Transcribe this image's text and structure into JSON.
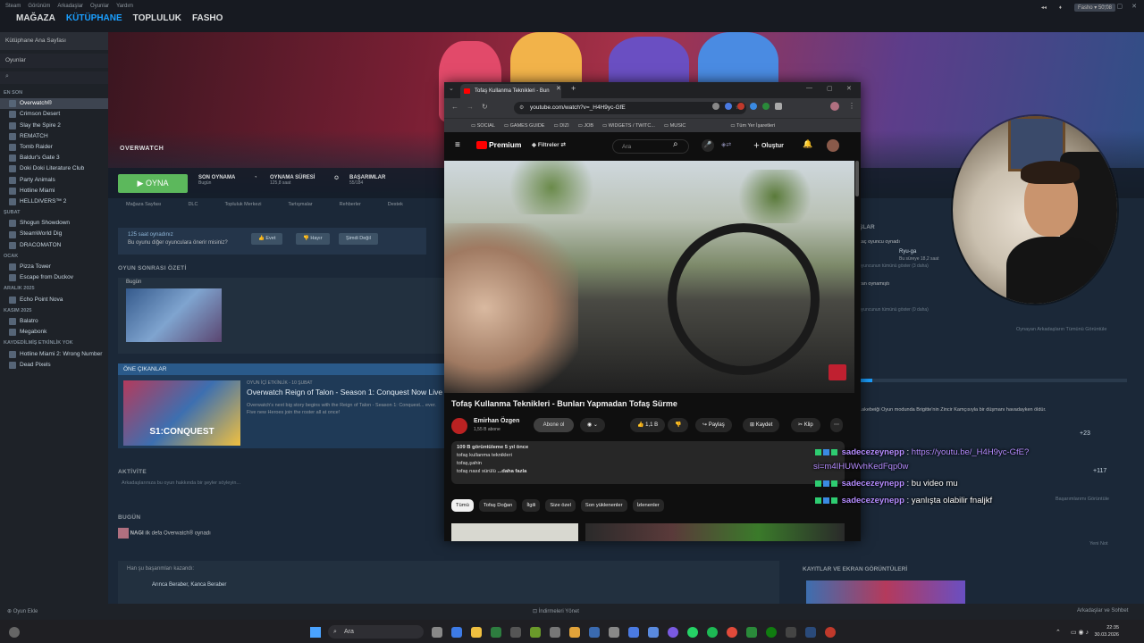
{
  "steam": {
    "menu": [
      "Steam",
      "Görünüm",
      "Arkadaşlar",
      "Oyunlar",
      "Yardım"
    ],
    "nav": [
      "MAĞAZA",
      "KÜTÜPHANE",
      "TOPLULUK",
      "FASHO"
    ],
    "account_name": "Fasho ▾ 50,08",
    "sidebar": {
      "home": "Kütüphane Ana Sayfası",
      "filter": "Oyunlar",
      "sections": [
        {
          "label": "EN SON",
          "games": [
            "Overwatch®",
            "Crimson Desert",
            "Slay the Spire 2",
            "REMATCH",
            "Tomb Raider",
            "Baldur's Gate 3",
            "Doki Doki Literature Club",
            "Party Animals",
            "Hotline Miami",
            "HELLDIVERS™ 2"
          ]
        },
        {
          "label": "ŞUBAT",
          "games": [
            "Shogun Showdown",
            "SteamWorld Dig",
            "DRACOMATON"
          ]
        },
        {
          "label": "OCAK",
          "games": [
            "Pizza Tower",
            "Escape from Duckov"
          ]
        },
        {
          "label": "ARALIK 2025",
          "games": [
            "Echo Point Nova"
          ]
        },
        {
          "label": "KASIM 2025",
          "games": [
            "Balatro",
            "Megabonk"
          ]
        },
        {
          "label": "KAYDEDİLMİŞ ETKİNLİK YOK",
          "games": [
            "Hotline Miami 2: Wrong Number",
            "Dead Pixels"
          ]
        }
      ]
    },
    "game": {
      "logo": "OVERWATCH",
      "play": "OYNA",
      "last_played_label": "SON OYNAMA",
      "last_played_value": "Bugün",
      "playtime_label": "OYNAMA SÜRESİ",
      "playtime_value": "125,8 saat",
      "achievements_label": "BAŞARIMLAR",
      "achievements_value": "55/184",
      "subnav": [
        "Mağaza Sayfası",
        "DLC",
        "Topluluk Merkezi",
        "Tartışmalar",
        "Rehberler",
        "Destek"
      ],
      "rec_line1": "125 saat oynadınız",
      "rec_line2": "Bu oyunu diğer oyunculara önerir misiniz?",
      "rec_yes": "Evet",
      "rec_no": "Hayır",
      "rec_later": "Şimdi Değil",
      "post_title": "OYUN SONRASI ÖZETİ",
      "post_today": "Bugün",
      "featured_head": "ÖNE ÇIKANLAR",
      "featured_meta": "OYUN İÇİ ETKİNLİK - 10 ŞUBAT",
      "featured_title": "Overwatch Reign of Talon - Season 1: Conquest Now Live",
      "featured_desc": "Overwatch's next big story begins with the Reign of Talon - Season 1: Conquest... ever. Five new Heroes join the roster all at once!",
      "featured_img_text": "S1:CONQUEST",
      "activity_title": "AKTİVİTE",
      "activity_placeholder": "Arkadaşlarınıza bu oyun hakkında bir şeyler söyleyin...",
      "today_title": "BUGÜN",
      "today_entry_name": "NAGI",
      "today_entry_text": "ilk defa",
      "today_entry_game": "Overwatch® oynadı",
      "ach_line": "Han şu başarımları kazandı:",
      "ach_name": "Arınca Beraber, Kanca Beraber",
      "friends_title": "ŞLAR",
      "friend_played": "kaç oyuncu oynadı",
      "friend_name": "Ryu-ga",
      "friend_sub": "Bu süreye 18,2 saat",
      "friend_link1": "oyuncunun tümünü göster (3 daha)",
      "friend_played2": "zan oynamıştı",
      "friend_link2": "oyuncunun tümünü göster (0 daha)",
      "friends_footer": "Oynayan Arkadaşların Tümünü Görüntüle",
      "ach_desc": "Lakebeiği Oyun modunda Brigitte'nin Zincir Kamçısıyla bir düşmanı havadayken öldür.",
      "ach_more1": "+23",
      "ach_more2": "+117",
      "ach_view_all": "Başarımlarımı Görüntüle",
      "news_view": "Yeni Not",
      "screens_title": "KAYITLAR VE EKRAN GÖRÜNTÜLERİ"
    },
    "status_left": "Oyun Ekle",
    "status_center": "İndirmeleri Yönet",
    "status_right": "Arkadaşlar ve Sohbet"
  },
  "browser": {
    "tab_title": "Tofaş Kullanma Teknikleri - Bun",
    "url": "youtube.com/watch?v=_H4H9yc-GfE",
    "bookmarks": [
      "SOCIAL",
      "GAMES GUIDE",
      "DIZI",
      "JOB",
      "WIDGETS / TWITC...",
      "MUSIC"
    ],
    "bookmarks_right": "Tüm Yer İşaretleri"
  },
  "youtube": {
    "logo": "Premium",
    "filters": "Filtreler",
    "search_placeholder": "Ara",
    "create": "Oluştur",
    "title": "Tofaş Kullanma Teknikleri - Bunları Yapmadan Tofaş Sürme",
    "channel": "Emirhan Özgen",
    "subs": "1,55 B abone",
    "subscribe": "Abone ol",
    "likes": "1,1 B",
    "share": "Paylaş",
    "save": "Kaydet",
    "clip": "Klip",
    "desc_stats": "109 B görüntüleme  5 yıl önce",
    "desc_lines": [
      "tofaş kullanma teknikleri",
      "tofaş,şahin",
      "tofaş nasıl sürülü"
    ],
    "desc_more": "...daha fazla",
    "chips": [
      "Tümü",
      "Tofaş Doğan",
      "İlgili",
      "Size özel",
      "Son yüklenenler",
      "İzlenenler"
    ]
  },
  "chat": [
    {
      "user": "sadecezeynepp",
      "text": "https://youtu.be/_H4H9yc-GfE?",
      "text2": "si=m4IHUWvhKedFqp0w",
      "is_link": true
    },
    {
      "user": "sadecezeynepp",
      "text": "bu video mu"
    },
    {
      "user": "sadecezeynepp",
      "text": "yanlışta olabilir fnaljkf"
    }
  ],
  "taskbar": {
    "search": "Ara",
    "time": "22:35",
    "date": "30.03.2026"
  },
  "colors": {
    "steam_bg": "#1b2838",
    "play_green": "#5cb85c",
    "yt_red": "#ff0000",
    "chat_user": "#b58cff"
  }
}
